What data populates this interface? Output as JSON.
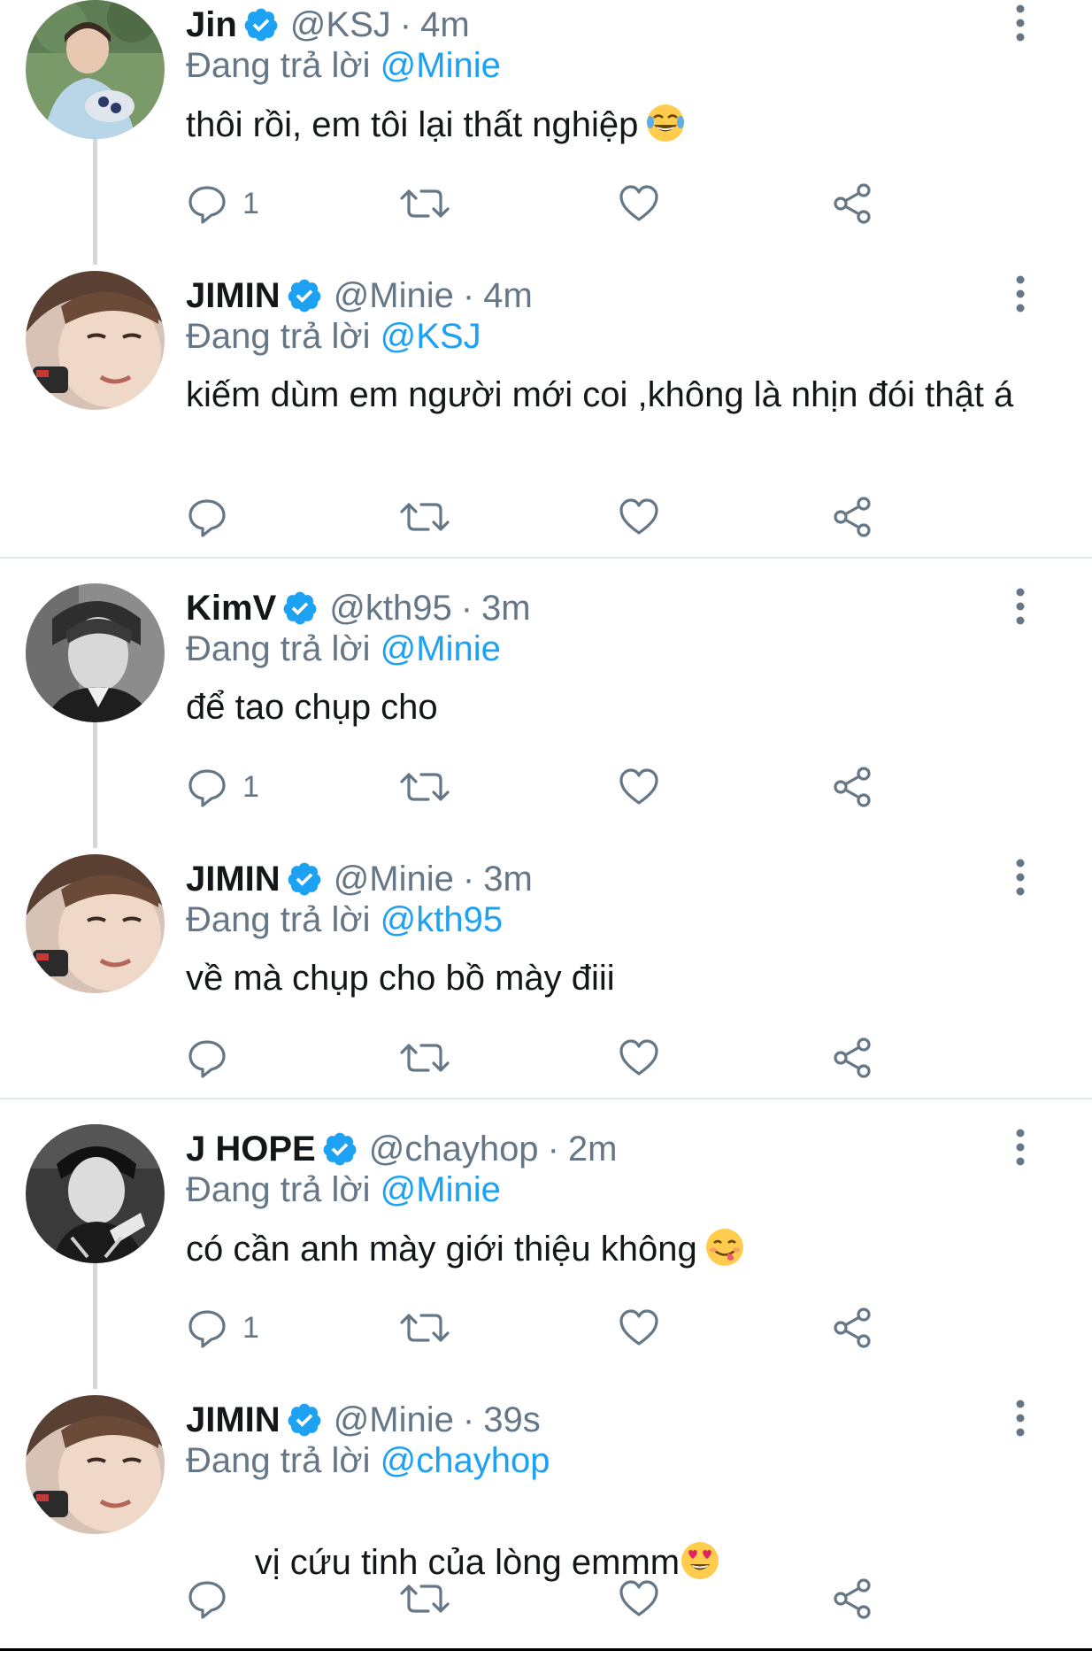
{
  "reply_prefix": "Đang trả lời",
  "colors": {
    "accent": "#1da1f2",
    "secondary_text": "#657786",
    "primary_text": "#14171a",
    "divider": "#e1e8ed"
  },
  "icons": {
    "verified": "verified-badge-icon",
    "more": "more-vertical-icon",
    "reply": "reply-icon",
    "retweet": "retweet-icon",
    "like": "heart-icon",
    "share": "share-icon"
  },
  "tweets": [
    {
      "name": "Jin",
      "handle": "@KSJ",
      "time": "4m",
      "reply_to": "@Minie",
      "text": "thôi rồi, em tôi lại thất nghiệp",
      "emoji": "tears-of-joy-emoji",
      "reply_count": "1"
    },
    {
      "name": "JIMIN",
      "handle": "@Minie",
      "time": "4m",
      "reply_to": "@KSJ",
      "text": "kiếm dùm em người mới coi ,không là nhịn đói thật á",
      "reply_count": ""
    },
    {
      "name": "KimV",
      "handle": "@kth95",
      "time": "3m",
      "reply_to": "@Minie",
      "text": "để tao chụp cho",
      "reply_count": "1"
    },
    {
      "name": "JIMIN",
      "handle": "@Minie",
      "time": "3m",
      "reply_to": "@kth95",
      "text": "về mà chụp cho bồ mày điii",
      "reply_count": ""
    },
    {
      "name": "J HOPE",
      "handle": "@chayhop",
      "time": "2m",
      "reply_to": "@Minie",
      "text": "có cần anh mày giới thiệu không",
      "emoji": "face-savoring-food-emoji",
      "reply_count": "1"
    },
    {
      "name": "JIMIN",
      "handle": "@Minie",
      "time": "39s",
      "reply_to": "@chayhop",
      "text": " vị cứu tinh của lòng emmm",
      "emoji": "heart-eyes-emoji",
      "reply_count": ""
    }
  ]
}
